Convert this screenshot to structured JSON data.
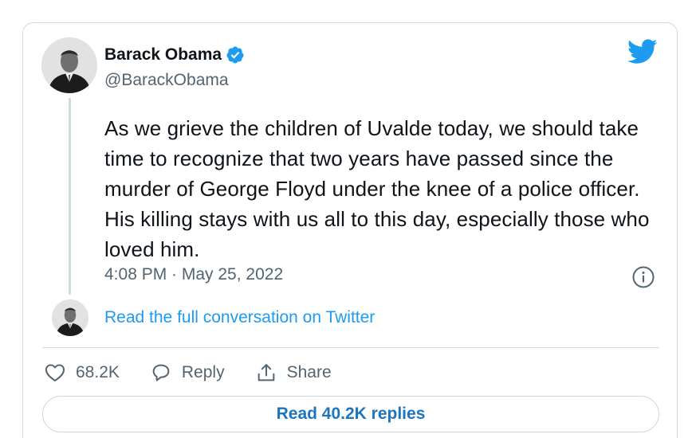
{
  "author": {
    "display_name": "Barack Obama",
    "handle": "@BarackObama",
    "verified": true
  },
  "tweet": {
    "text": "As we grieve the children of Uvalde today, we should take time to recognize that two years have passed since the murder of George Floyd under the knee of a police officer. His killing stays with us all to this day, especially those who loved him.",
    "timestamp": "4:08 PM · May 25, 2022"
  },
  "conversation": {
    "link_label": "Read the full conversation on Twitter"
  },
  "actions": {
    "likes": "68.2K",
    "reply_label": "Reply",
    "share_label": "Share"
  },
  "replies_button": {
    "label": "Read 40.2K replies"
  },
  "icons": {
    "brand": "twitter-bird-icon",
    "verified": "verified-badge-icon",
    "info": "info-icon",
    "like": "heart-icon",
    "reply": "speech-bubble-icon",
    "share": "share-upload-icon"
  },
  "colors": {
    "accent": "#1d9bf0",
    "button_text": "#1d75c0",
    "secondary_text": "#536471",
    "border": "#cfd9de"
  }
}
